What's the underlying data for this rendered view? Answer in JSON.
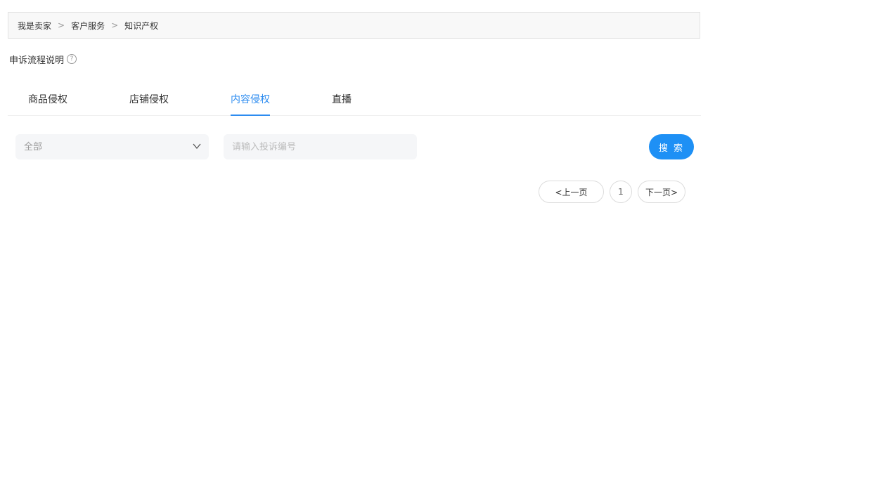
{
  "breadcrumb": {
    "items": [
      "我是卖家",
      "客户服务",
      "知识产权"
    ],
    "separator": ">"
  },
  "process": {
    "label": "申诉流程说明",
    "help_icon": "question-circle-icon",
    "help_glyph": "?"
  },
  "tabs": [
    {
      "label": "商品侵权",
      "active": false
    },
    {
      "label": "店铺侵权",
      "active": false
    },
    {
      "label": "内容侵权",
      "active": true
    },
    {
      "label": "直播",
      "active": false
    }
  ],
  "filter": {
    "select_value": "全部",
    "search_placeholder": "请输入投诉编号",
    "search_value": "",
    "search_button": "搜 索"
  },
  "pagination": {
    "prev": "<上一页",
    "current_page": "1",
    "next": "下一页>"
  },
  "colors": {
    "accent": "#2d8cf0",
    "button": "#1e90f5",
    "input_bg": "#f5f6f8",
    "breadcrumb_bg": "#f8f8f8"
  }
}
